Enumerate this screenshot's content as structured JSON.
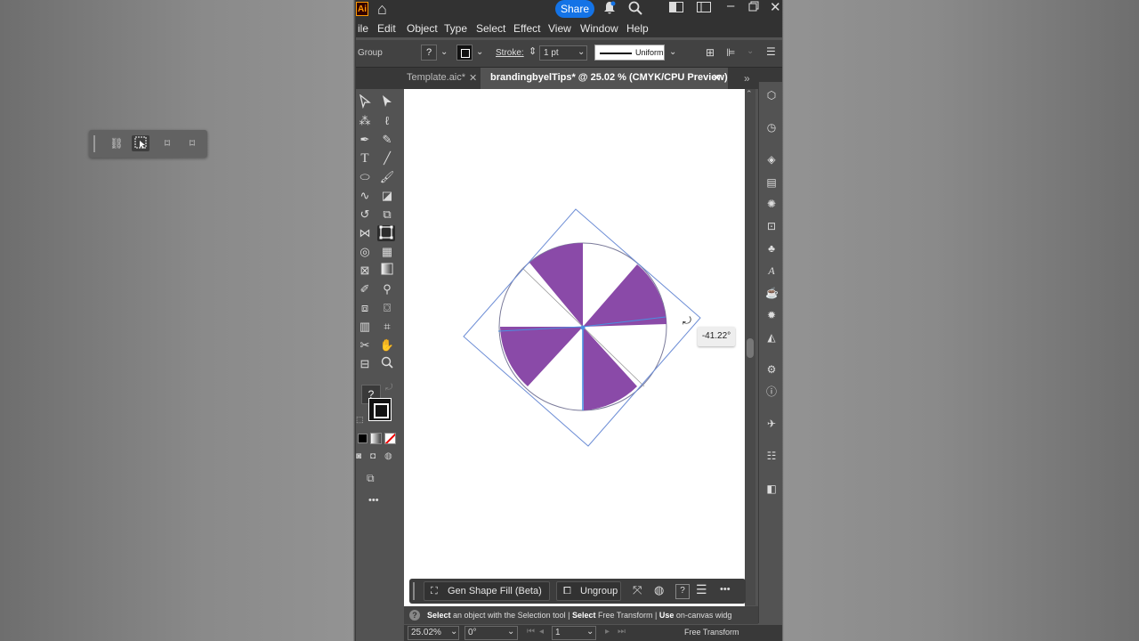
{
  "titlebar": {
    "logo": "Ai",
    "share_label": "Share",
    "icons": [
      "home-icon",
      "bell-icon",
      "search-icon",
      "arrange-documents-icon",
      "workspace-icon",
      "minimize-icon",
      "restore-icon",
      "close-icon"
    ]
  },
  "menu": {
    "items": [
      "ile",
      "Edit",
      "Object",
      "Type",
      "Select",
      "Effect",
      "View",
      "Window",
      "Help"
    ]
  },
  "control": {
    "selection_label": "Group",
    "stroke_label": "Stroke:",
    "stroke_value": "1 pt",
    "profile_label": "Uniform",
    "fill_help": "?"
  },
  "tabs": [
    {
      "label": "Template.aic*",
      "close": "✕"
    },
    {
      "label": "brandingbyelTips* @ 25.02 % (CMYK/CPU Preview)",
      "close": "✕"
    }
  ],
  "tools": {
    "help": "?",
    "more": "•••"
  },
  "canvas": {
    "rotation_readout": "-41.22°",
    "accent_color": "#8a4aa8",
    "bbox_color": "#6f8fd6"
  },
  "context_bar": {
    "gen_fill": "Gen Shape Fill (Beta)",
    "ungroup": "Ungroup",
    "help": "?",
    "more": "•••"
  },
  "status": {
    "hint_p1": "Select",
    "hint_p2": " an object with the Selection tool  |  ",
    "hint_p3": "Select",
    "hint_p4": " Free Transform  |  ",
    "hint_p5": "Use",
    "hint_p6": " on-canvas widg"
  },
  "bottom": {
    "zoom": "25.02%",
    "angle": "0°",
    "artboard": "1",
    "tool_name": "Free Transform"
  }
}
